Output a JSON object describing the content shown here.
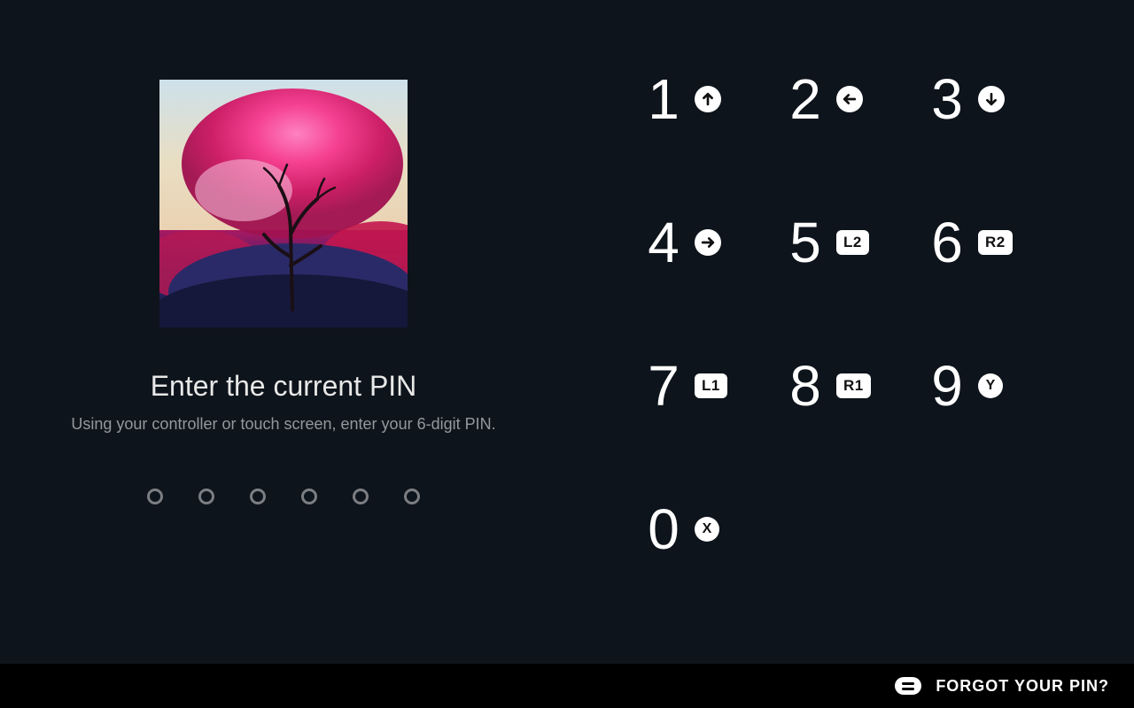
{
  "left": {
    "title": "Enter the current PIN",
    "subtitle": "Using your controller or touch screen, enter your 6-digit PIN.",
    "pin_length": 6
  },
  "keypad": [
    [
      {
        "digit": "1",
        "badge_type": "arrow",
        "arrow": "up",
        "name": "key-1",
        "icon": "arrow-up-icon"
      },
      {
        "digit": "2",
        "badge_type": "arrow",
        "arrow": "left",
        "name": "key-2",
        "icon": "arrow-left-icon"
      },
      {
        "digit": "3",
        "badge_type": "arrow",
        "arrow": "down",
        "name": "key-3",
        "icon": "arrow-down-icon"
      }
    ],
    [
      {
        "digit": "4",
        "badge_type": "arrow",
        "arrow": "right",
        "name": "key-4",
        "icon": "arrow-right-icon"
      },
      {
        "digit": "5",
        "badge_type": "sq",
        "label": "L2",
        "name": "key-5",
        "icon": "l2-badge"
      },
      {
        "digit": "6",
        "badge_type": "sq",
        "label": "R2",
        "name": "key-6",
        "icon": "r2-badge"
      }
    ],
    [
      {
        "digit": "7",
        "badge_type": "sq",
        "label": "L1",
        "name": "key-7",
        "icon": "l1-badge"
      },
      {
        "digit": "8",
        "badge_type": "sq",
        "label": "R1",
        "name": "key-8",
        "icon": "r1-badge"
      },
      {
        "digit": "9",
        "badge_type": "letter",
        "label": "Y",
        "name": "key-9",
        "icon": "y-button-icon"
      }
    ],
    [
      {
        "digit": "0",
        "badge_type": "letter",
        "label": "X",
        "name": "key-0",
        "icon": "x-button-icon"
      }
    ]
  ],
  "footer": {
    "label": "FORGOT YOUR PIN?"
  }
}
